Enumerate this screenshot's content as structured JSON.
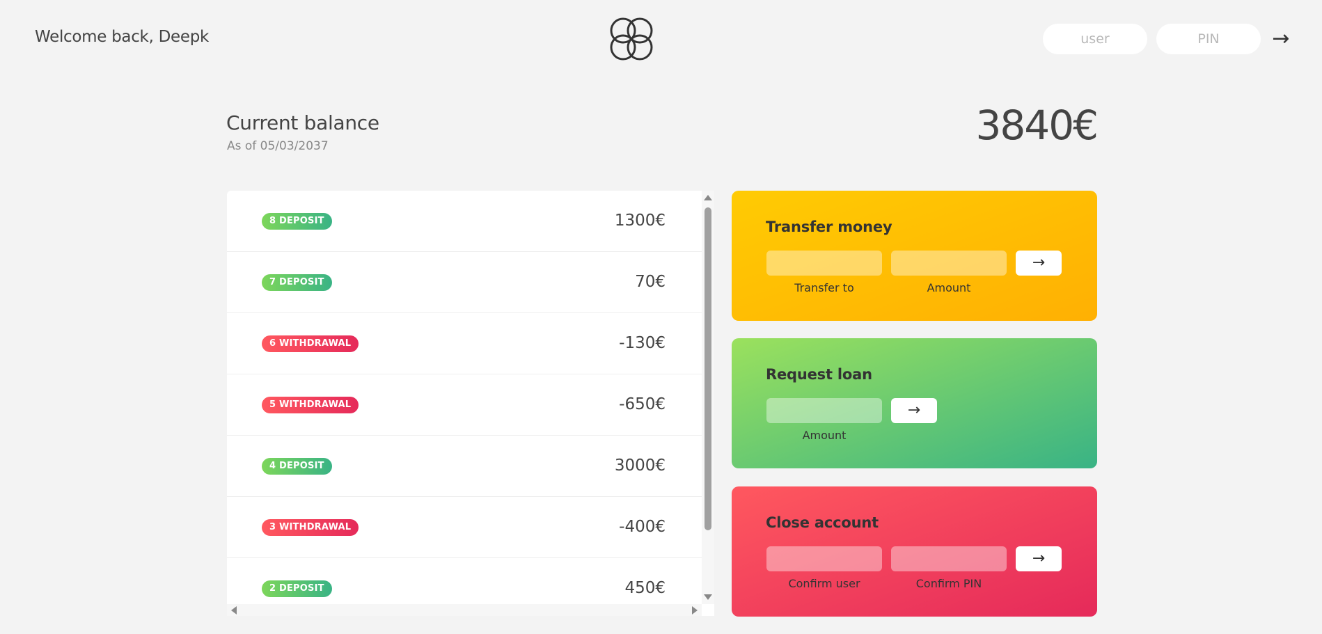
{
  "nav": {
    "welcome": "Welcome back, Deepk",
    "logo_icon": "interlocking-rings-logo",
    "user_placeholder": "user",
    "pin_placeholder": "PIN",
    "login_button": "→"
  },
  "balance": {
    "label": "Current balance",
    "date": "As of 05/03/2037",
    "value": "3840€"
  },
  "movements": [
    {
      "type": "8 DEPOSIT",
      "kind": "deposit",
      "value": "1300€"
    },
    {
      "type": "7 DEPOSIT",
      "kind": "deposit",
      "value": "70€"
    },
    {
      "type": "6 WITHDRAWAL",
      "kind": "withdrawal",
      "value": "-130€"
    },
    {
      "type": "5 WITHDRAWAL",
      "kind": "withdrawal",
      "value": "-650€"
    },
    {
      "type": "4 DEPOSIT",
      "kind": "deposit",
      "value": "3000€"
    },
    {
      "type": "3 WITHDRAWAL",
      "kind": "withdrawal",
      "value": "-400€"
    },
    {
      "type": "2 DEPOSIT",
      "kind": "deposit",
      "value": "450€"
    }
  ],
  "operations": {
    "transfer": {
      "title": "Transfer money",
      "label_to": "Transfer to",
      "label_amount": "Amount",
      "button": "→"
    },
    "loan": {
      "title": "Request loan",
      "label_amount": "Amount",
      "button": "→"
    },
    "close": {
      "title": "Close account",
      "label_user": "Confirm user",
      "label_pin": "Confirm PIN",
      "button": "→"
    }
  },
  "colors": {
    "deposit": "#39b385",
    "withdrawal": "#e52a5a",
    "transfer": "#ffb003",
    "loan": "#9be15d",
    "close": "#ff585f"
  }
}
